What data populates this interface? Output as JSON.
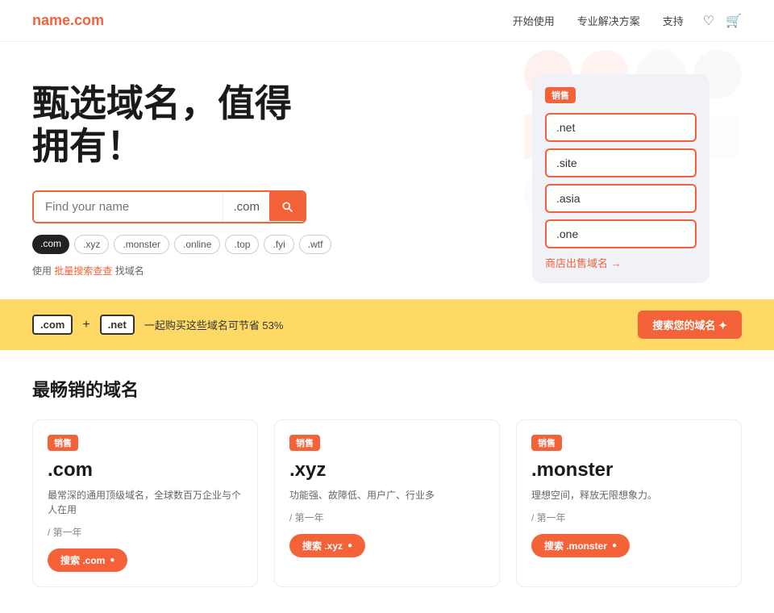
{
  "nav": {
    "logo": "name.com",
    "logo_dot": ".",
    "links": [
      {
        "label": "开始使用",
        "name": "nav-start"
      },
      {
        "label": "专业解决方案",
        "name": "nav-pro"
      },
      {
        "label": "支持",
        "name": "nav-support"
      }
    ]
  },
  "hero": {
    "title_line1": "甄选域名，值得",
    "title_line2": "拥有！",
    "search_placeholder": "Find your name",
    "search_tld": ".com",
    "tags": [
      {
        "label": ".com",
        "active": true
      },
      {
        "label": ".xyz",
        "active": false
      },
      {
        "label": ".monster",
        "active": false
      },
      {
        "label": ".online",
        "active": false
      },
      {
        "label": ".top",
        "active": false
      },
      {
        "label": ".fyi",
        "active": false
      },
      {
        "label": ".wtf",
        "active": false
      }
    ],
    "bulk_prefix": "使用",
    "bulk_link": "批量搜索查查",
    "bulk_suffix": "找域名"
  },
  "domain_panel": {
    "badge": "销售",
    "items": [
      ".net",
      ".site",
      ".asia",
      ".one"
    ],
    "store_link": "商店出售域名 →"
  },
  "banner": {
    "tag1": ".com",
    "plus": "+",
    "tag2": ".net",
    "text": "一起购买这些域名可节省 53%",
    "button": "搜索您的域名 ✦"
  },
  "bestsellers": {
    "title": "最畅销的域名",
    "cards": [
      {
        "badge": "销售",
        "tld": ".com",
        "desc": "最常深的通用顶级域名，全球数百万企业与个人在用",
        "year_label": "/ 第一年",
        "btn_label": "搜索 .com",
        "btn_dot": "●"
      },
      {
        "badge": "销售",
        "tld": ".xyz",
        "desc": "功能强、故障低、用户广、行业多",
        "year_label": "/ 第一年",
        "btn_label": "搜索 .xyz",
        "btn_dot": "●"
      },
      {
        "badge": "销售",
        "tld": ".monster",
        "desc": "理想空间，释放无限想象力。",
        "year_label": "/ 第一年",
        "btn_label": "搜索 .monster",
        "btn_dot": "●"
      }
    ]
  },
  "colors": {
    "accent": "#f4623a",
    "banner_bg": "#ffd966"
  }
}
